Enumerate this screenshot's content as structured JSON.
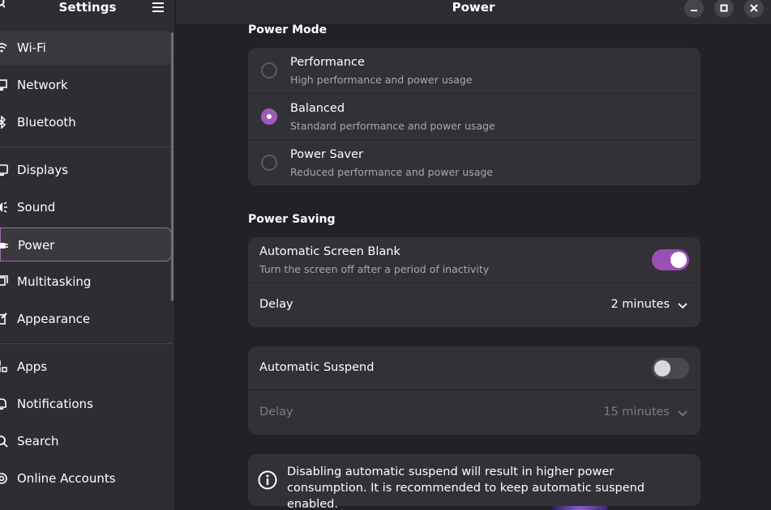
{
  "sidebar": {
    "title": "Settings",
    "items": [
      {
        "label": "Wi-Fi",
        "icon": "wifi-icon"
      },
      {
        "label": "Network",
        "icon": "network-icon"
      },
      {
        "label": "Bluetooth",
        "icon": "bluetooth-icon"
      },
      {
        "label": "Displays",
        "icon": "display-icon"
      },
      {
        "label": "Sound",
        "icon": "sound-icon"
      },
      {
        "label": "Power",
        "icon": "power-icon"
      },
      {
        "label": "Multitasking",
        "icon": "multitasking-icon"
      },
      {
        "label": "Appearance",
        "icon": "appearance-icon"
      },
      {
        "label": "Apps",
        "icon": "apps-icon"
      },
      {
        "label": "Notifications",
        "icon": "notifications-icon"
      },
      {
        "label": "Search",
        "icon": "search-icon"
      },
      {
        "label": "Online Accounts",
        "icon": "online-accounts-icon"
      }
    ],
    "active_item": "Power"
  },
  "header": {
    "title": "Power"
  },
  "power_mode": {
    "title": "Power Mode",
    "options": [
      {
        "title": "Performance",
        "subtitle": "High performance and power usage",
        "selected": false
      },
      {
        "title": "Balanced",
        "subtitle": "Standard performance and power usage",
        "selected": true
      },
      {
        "title": "Power Saver",
        "subtitle": "Reduced performance and power usage",
        "selected": false
      }
    ]
  },
  "power_saving": {
    "title": "Power Saving",
    "screen_blank": {
      "title": "Automatic Screen Blank",
      "subtitle": "Turn the screen off after a period of inactivity",
      "enabled": true,
      "delay_label": "Delay",
      "delay_value": "2 minutes"
    },
    "suspend": {
      "title": "Automatic Suspend",
      "enabled": false,
      "delay_label": "Delay",
      "delay_value": "15 minutes"
    },
    "info": "Disabling automatic suspend will result in higher power consumption. It is recommended to keep automatic suspend enabled."
  },
  "colors": {
    "accent": "#9a4fb6",
    "sidebar_bg": "#2e2e32",
    "main_bg": "#222226",
    "card_bg": "#323236"
  }
}
